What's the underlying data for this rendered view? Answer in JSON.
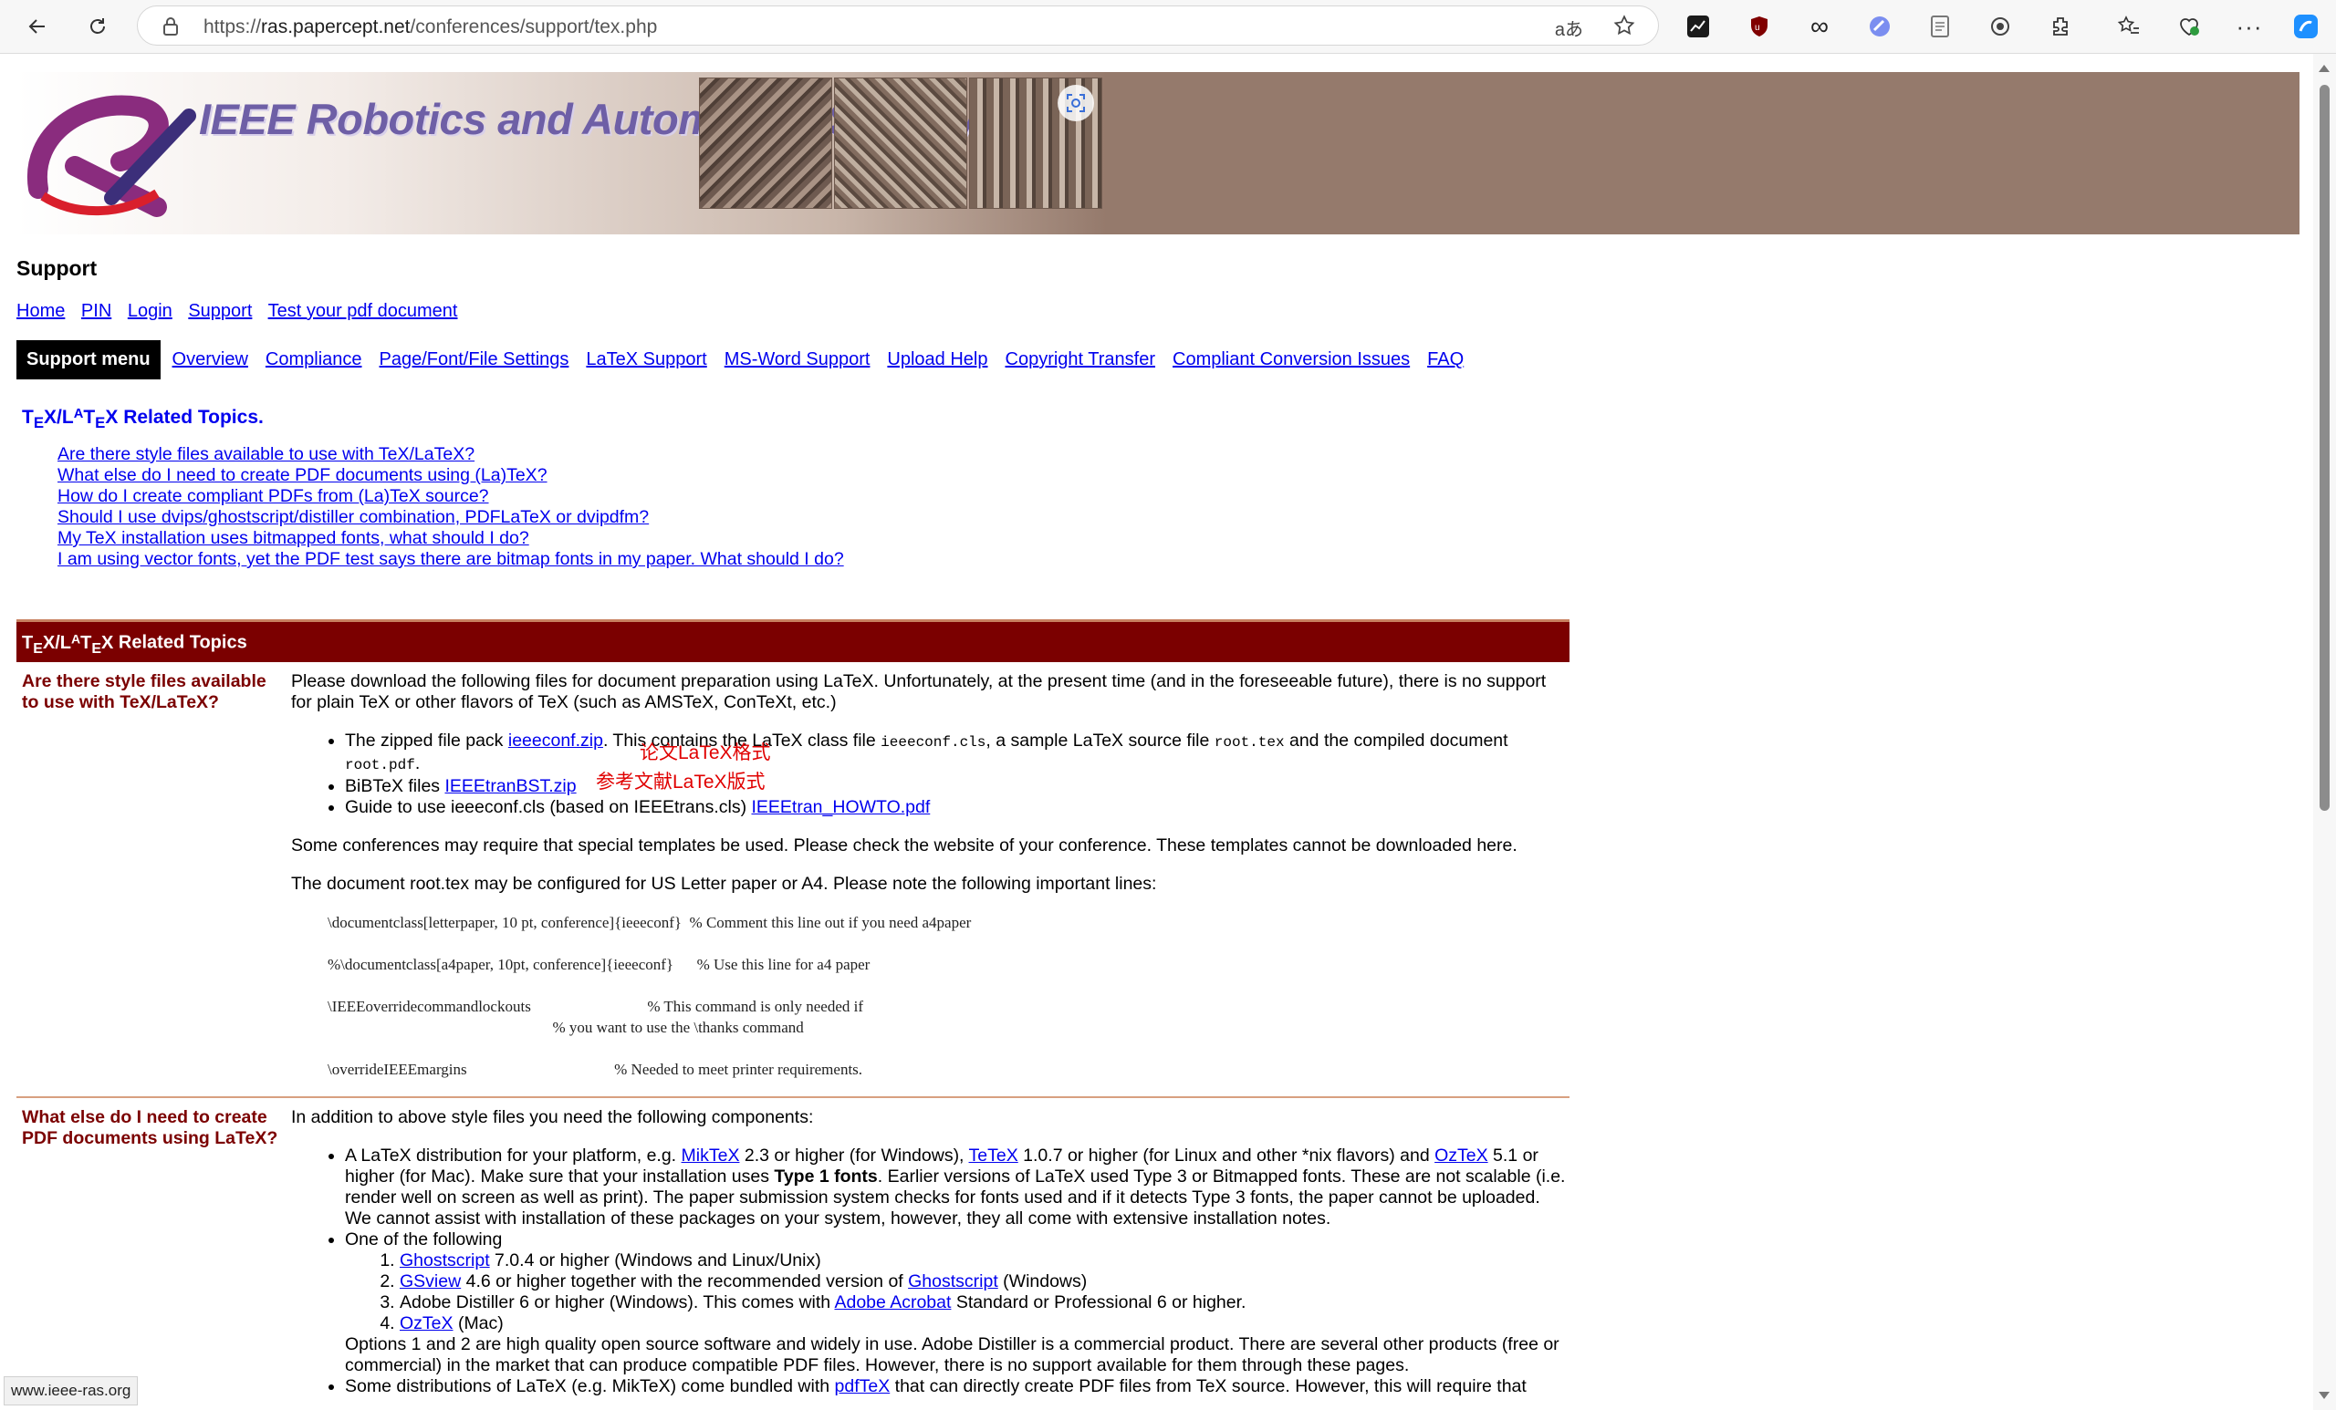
{
  "browser": {
    "url_prefix": "https://",
    "url_host": "ras.papercept.net",
    "url_path": "/conferences/support/tex.php",
    "read_aloud_glyph": "aあ",
    "status_url": "www.ieee-ras.org"
  },
  "banner": {
    "title": "IEEE Robotics and Automation Society"
  },
  "page": {
    "heading": "Support",
    "topnav": [
      "Home",
      "PIN",
      "Login",
      "Support",
      "Test your pdf document"
    ],
    "support_menu_label": "Support menu",
    "menu": [
      "Overview",
      "Compliance",
      "Page/Font/File Settings",
      "LaTeX Support",
      "MS-Word Support",
      "Upload Help",
      "Copyright Transfer",
      "Compliant Conversion Issues",
      "FAQ"
    ],
    "related_heading_suffix": " Related Topics.",
    "toc": [
      "Are there style files available to use with TeX/LaTeX?",
      "What else do I need to create PDF documents using (La)TeX?",
      "How do I create compliant PDFs from (La)TeX source?",
      "Should I use dvips/ghostscript/distiller combination, PDFLaTeX or dvipdfm?",
      "My TeX installation uses bitmapped fonts, what should I do?",
      "I am using vector fonts, yet the PDF test says there are bitmap fonts in my paper. What should I do?"
    ]
  },
  "table": {
    "header_suffix": " Related Topics",
    "row1": {
      "question": "Are there style files available to use with TeX/LaTeX?",
      "intro": "Please download the following files for document preparation using LaTeX. Unfortunately, at the present time (and in the foreseeable future), there is no support for plain TeX or other flavors of TeX (such as AMSTeX, ConTeXt, etc.)",
      "b1_pre": "The zipped file pack ",
      "b1_link": "ieeeconf.zip",
      "b1_mid": ". This contains the LaTeX class file ",
      "b1_code1": "ieeeconf.cls",
      "b1_mid2": ", a sample LaTeX source file ",
      "b1_code2": "root.tex",
      "b1_mid3": " and the compiled document ",
      "b1_code3": "root.pdf",
      "b1_end": ".",
      "b2_pre": "BiBTeX files ",
      "b2_link": "IEEEtranBST.zip",
      "b3_pre": "Guide to use ieeeconf.cls (based on IEEEtrans.cls) ",
      "b3_link": "IEEEtran_HOWTO.pdf",
      "ann1": "论文LaTeX格式",
      "ann2": "参考文献LaTeX版式",
      "p2": "Some conferences may require that special templates be used. Please check the website of your conference. These templates cannot be downloaded here.",
      "p3": "The document root.tex may be configured for US Letter paper or A4. Please note the following important lines:",
      "code": "\\documentclass[letterpaper, 10 pt, conference]{ieeeconf}  % Comment this line out if you need a4paper\n\n%\\documentclass[a4paper, 10pt, conference]{ieeeconf}      % Use this line for a4 paper\n\n\\IEEEoverridecommandlockouts                              % This command is only needed if\n                                                          % you want to use the \\thanks command\n\n\\overrideIEEEmargins                                      % Needed to meet printer requirements."
    },
    "row2": {
      "question": "What else do I need to create PDF documents using LaTeX?",
      "intro": "In addition to above style files you need the following components:",
      "b1_a": "A LaTeX distribution for your platform, e.g. ",
      "miktex": "MikTeX",
      "b1_b": " 2.3 or higher (for Windows), ",
      "tetex": "TeTeX",
      "b1_c": " 1.0.7 or higher (for Linux and other *nix flavors) and ",
      "oztex": "OzTeX",
      "b1_d": " 5.1 or higher (for Mac). Make sure that your installation uses ",
      "b1_bold": "Type 1 fonts",
      "b1_e": ". Earlier versions of LaTeX used Type 3 or Bitmapped fonts. These are not scalable (i.e. render well on screen as well as print). The paper submission system checks for fonts used and if it detects Type 3 fonts, the paper cannot be uploaded. We cannot assist with installation of these packages on your system, however, they all come with extensive installation notes.",
      "b2": "One of the following",
      "o1_link": "Ghostscript",
      "o1_text": " 7.0.4 or higher (Windows and Linux/Unix)",
      "o2_link": "GSview",
      "o2_text": " 4.6 or higher together with the recommended version of ",
      "o2_link2": "Ghostscript",
      "o2_end": " (Windows)",
      "o3_text": "Adobe Distiller 6 or higher (Windows). This comes with ",
      "o3_link": "Adobe Acrobat",
      "o3_end": " Standard or Professional 6 or higher.",
      "o4_link": "OzTeX",
      "o4_end": " (Mac)",
      "options_note": "Options 1 and 2 are high quality open source software and widely in use. Adobe Distiller is a commercial product. There are several other products (free or commercial) in the market that can produce compatible PDF files. However, there is no support available for them through these pages.",
      "b3_pre": "Some distributions of LaTeX (e.g. MikTeX) come bundled with ",
      "b3_link": "pdfTeX",
      "b3_end": " that can directly create PDF files from TeX source. However, this will require that"
    }
  }
}
